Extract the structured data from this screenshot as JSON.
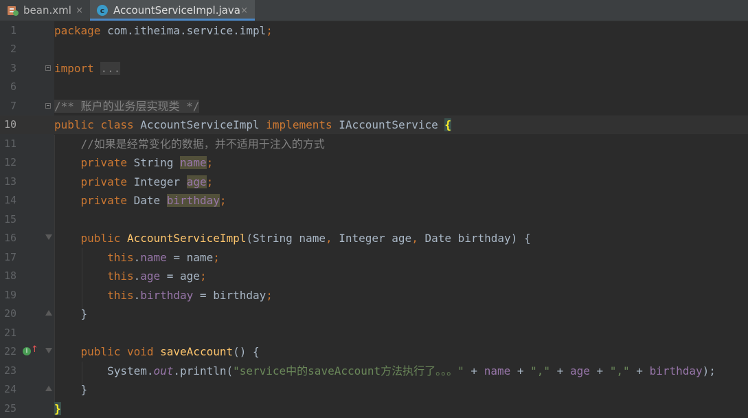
{
  "tabs": [
    {
      "label": "bean.xml",
      "icon": "xml-file-icon",
      "active": false
    },
    {
      "label": "AccountServiceImpl.java",
      "icon": "java-class-icon",
      "active": true
    }
  ],
  "close_glyph": "×",
  "editor": {
    "current_line": 10,
    "lines": [
      {
        "num": "1"
      },
      {
        "num": "2"
      },
      {
        "num": "3"
      },
      {
        "num": "6"
      },
      {
        "num": "7"
      },
      {
        "num": "10"
      },
      {
        "num": "11"
      },
      {
        "num": "12"
      },
      {
        "num": "13"
      },
      {
        "num": "14"
      },
      {
        "num": "15"
      },
      {
        "num": "16"
      },
      {
        "num": "17"
      },
      {
        "num": "18"
      },
      {
        "num": "19"
      },
      {
        "num": "20"
      },
      {
        "num": "21"
      },
      {
        "num": "22"
      },
      {
        "num": "23"
      },
      {
        "num": "24"
      },
      {
        "num": "25"
      }
    ],
    "t": {
      "package_kw": "package",
      "package_name": " com.itheima.service.impl",
      "semi": ";",
      "import_kw": "import",
      "import_fold": "...",
      "doc_comment": "/** 账户的业务层实现类 */",
      "public_kw": "public",
      "class_kw": "class",
      "class_name": "AccountServiceImpl",
      "implements_kw": "implements",
      "iface": "IAccountService",
      "open_brace": "{",
      "close_brace": "}",
      "line_comment": "//如果是经常变化的数据，并不适用于注入的方式",
      "private_kw": "private",
      "type_string": "String",
      "type_integer": "Integer",
      "type_date": "Date",
      "f_name": "name",
      "f_age": "age",
      "f_birthday": "birthday",
      "ctor_name": "AccountServiceImpl",
      "ctor_params_a": "(String name",
      "comma": ",",
      "ctor_params_b": " Integer age",
      "ctor_params_c": " Date birthday) {",
      "this_kw": "this",
      "dot": ".",
      "assign_name": " = name",
      "assign_age": " = age",
      "assign_birthday": " = birthday",
      "void_kw": "void",
      "method_name": "saveAccount",
      "method_sig": "() {",
      "sys": "System.",
      "out": "out",
      "println": ".println(",
      "str1": "\"service中的saveAccount方法执行了。。。\"",
      "plus": " + ",
      "str_comma": "\",\"",
      "end_call": ");"
    }
  }
}
